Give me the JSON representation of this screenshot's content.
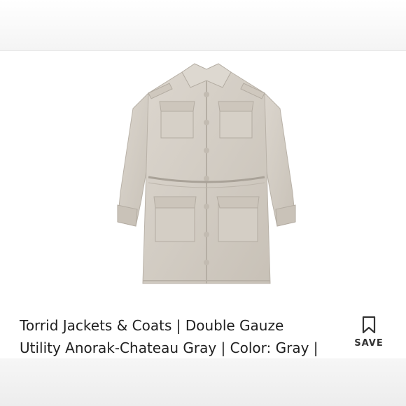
{
  "product": {
    "title_line1": "Torrid Jackets & Coats | Double Gauze",
    "title_line2": "Utility Anorak-Chateau Gray | Color: Gray |",
    "image_alt": "Chateau gray utility anorak jacket",
    "image_color": "#d6d0c8"
  },
  "actions": {
    "save_icon": "bookmark-icon",
    "save_label": "SAVE"
  }
}
